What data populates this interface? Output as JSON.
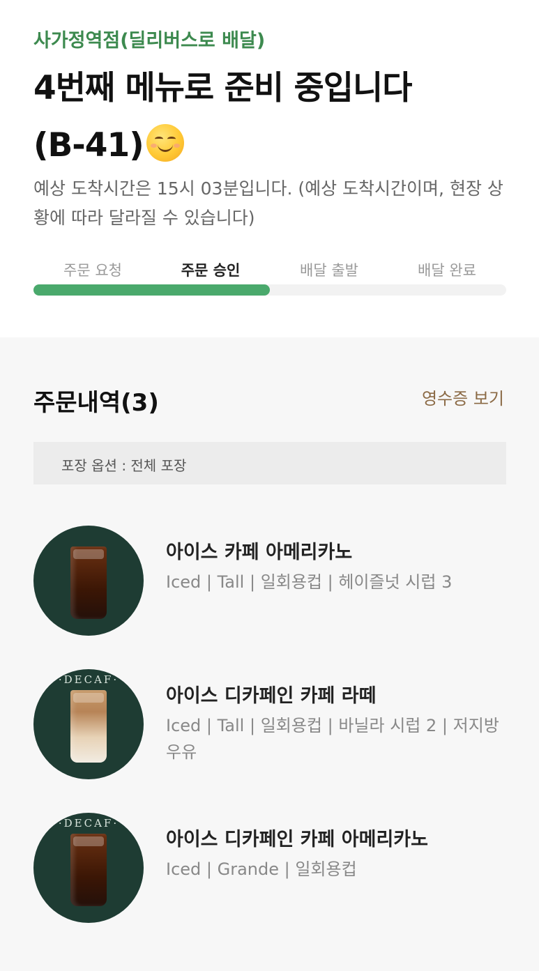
{
  "header": {
    "store": "사가정역점(딜리버스로 배달)",
    "headline_line1": "4번째 메뉴로 준비 중입니다",
    "headline_line2": "(B-41)",
    "emoji": "smiling-face-icon",
    "eta_text": "예상 도착시간은 15시 03분입니다. (예상 도착시간이며, 현장 상황에 따라 달라질 수 있습니다)"
  },
  "progress": {
    "steps": [
      "주문 요청",
      "주문 승인",
      "배달 출발",
      "배달 완료"
    ],
    "active_index": 1,
    "fraction": 0.5,
    "color": "#4aa96c"
  },
  "order": {
    "title": "주문내역(3)",
    "receipt_link": "영수증 보기",
    "packing_option": "포장 옵션 : 전체 포장",
    "items": [
      {
        "name": "아이스 카페 아메리카노",
        "options": "Iced | Tall | 일회용컵 | 헤이즐넛 시럽 3",
        "decaf_label": "",
        "drink": "americano"
      },
      {
        "name": "아이스 디카페인 카페 라떼",
        "options": "Iced | Tall | 일회용컵 | 바닐라 시럽 2 | 저지방 우유",
        "decaf_label": "·DECAF·",
        "drink": "latte"
      },
      {
        "name": "아이스 디카페인 카페 아메리카노",
        "options": "Iced | Grande | 일회용컵",
        "decaf_label": "·DECAF·",
        "drink": "americano"
      }
    ]
  },
  "colors": {
    "brand_green": "#3d8a4f",
    "receipt_brown": "#8b6a45",
    "thumb_bg": "#1e3c33"
  }
}
